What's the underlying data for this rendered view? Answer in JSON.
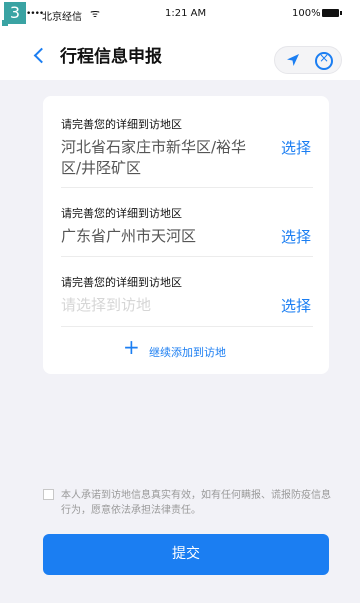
{
  "step_badge": "3",
  "status_bar": {
    "signal": "••••",
    "carrier": "北京经信",
    "wifi": "ᯤ",
    "time": "1:21 AM",
    "battery": "100%"
  },
  "nav": {
    "title": "行程信息申报",
    "back_icon": "chevron-left-icon",
    "location_icon": "location-arrow-icon",
    "close_icon": "close-circle-icon"
  },
  "destinations": [
    {
      "label": "请完善您的详细到访地区",
      "value": "河北省石家庄市新华区/裕华区/井陉矿区",
      "placeholder": false,
      "action": "选择"
    },
    {
      "label": "请完善您的详细到访地区",
      "value": "广东省广州市天河区",
      "placeholder": false,
      "action": "选择"
    },
    {
      "label": "请完善您的详细到访地区",
      "value": "请选择到访地",
      "placeholder": true,
      "action": "选择"
    }
  ],
  "add_more": {
    "icon": "plus-icon",
    "label": "继续添加到访地"
  },
  "agreement": {
    "text": "本人承诺到访地信息真实有效，如有任何瞒报、谎报防疫信息行为，愿意依法承担法律责任。",
    "checked": false
  },
  "submit": {
    "label": "提交"
  },
  "colors": {
    "accent": "#1b7ef2",
    "background": "#f2f2f7",
    "badge": "#3aa3a3"
  }
}
